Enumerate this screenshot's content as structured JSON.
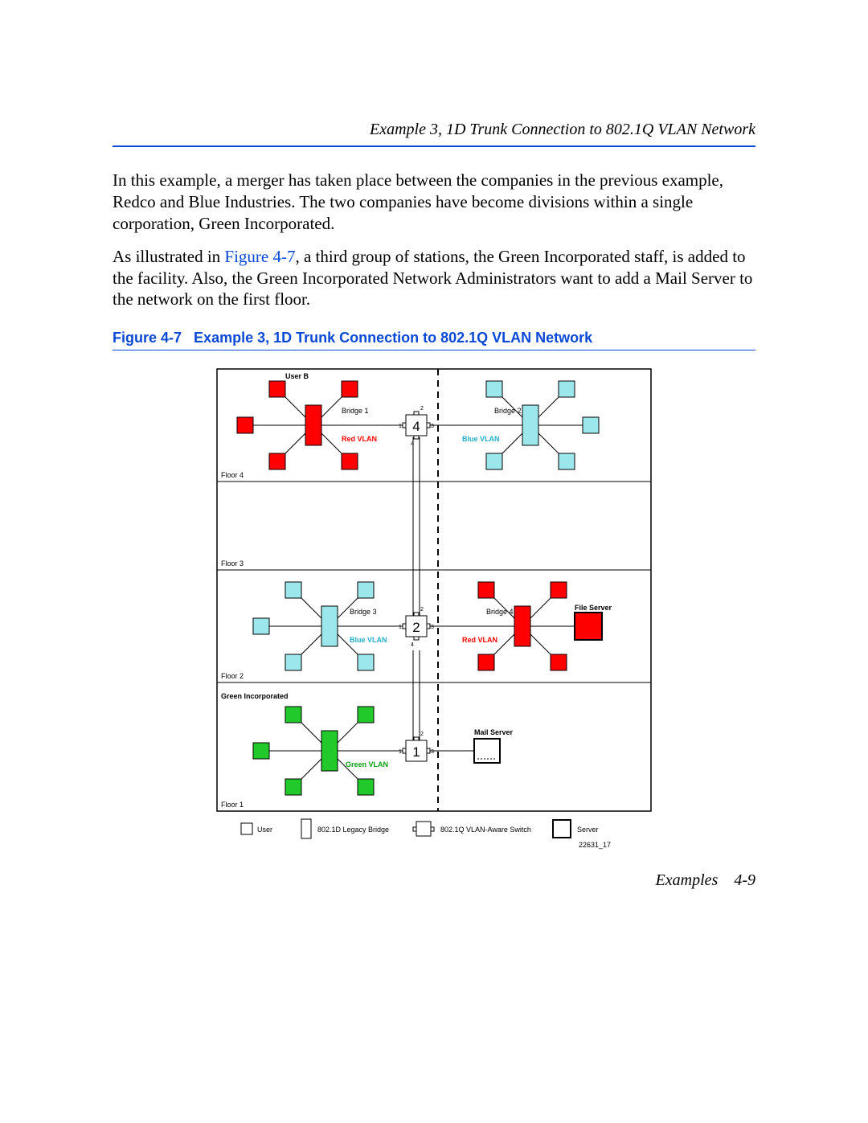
{
  "header": {
    "running": "Example 3, 1D Trunk Connection to 802.1Q VLAN Network"
  },
  "paras": {
    "p1a": "In this example, a merger has taken place between the companies in the previous example, Redco and Blue Industries. The two companies have become divisions within a single corporation, Green Incorporated.",
    "p2a": "As illustrated in ",
    "p2link": "Figure 4-7",
    "p2b": ", a third group of stations, the Green Incorporated staff, is added to the facility. Also, the Green Incorporated Network Administrators want to add a Mail Server to the network on the first floor."
  },
  "figcap": {
    "prefix": "Figure 4-7",
    "title": "Example 3, 1D Trunk Connection to 802.1Q VLAN Network"
  },
  "diagram": {
    "floors": {
      "f4": "Floor 4",
      "f3": "Floor 3",
      "f2": "Floor 2",
      "f1": "Floor 1"
    },
    "labels": {
      "userB": "User B",
      "bridge1": "Bridge 1",
      "bridge2": "Bridge 2",
      "bridge3": "Bridge 3",
      "bridge4": "Bridge 4",
      "fileServer": "File Server",
      "mailServer": "Mail Server",
      "greenInc": "Green Incorporated",
      "redVlan": "Red VLAN",
      "blueVlan": "Blue VLAN",
      "greenVlan": "Green VLAN"
    },
    "switchNums": {
      "top": "4",
      "mid": "2",
      "bot": "1"
    },
    "portNums": {
      "p1": "1",
      "p2": "2",
      "p3": "3",
      "p4": "4"
    },
    "legend": {
      "user": "User",
      "bridge": "802.1D Legacy Bridge",
      "switch": "802.1Q VLAN-Aware Switch",
      "server": "Server"
    },
    "imageId": "22631_17"
  },
  "footer": {
    "left": "Examples",
    "right": "4-9"
  }
}
